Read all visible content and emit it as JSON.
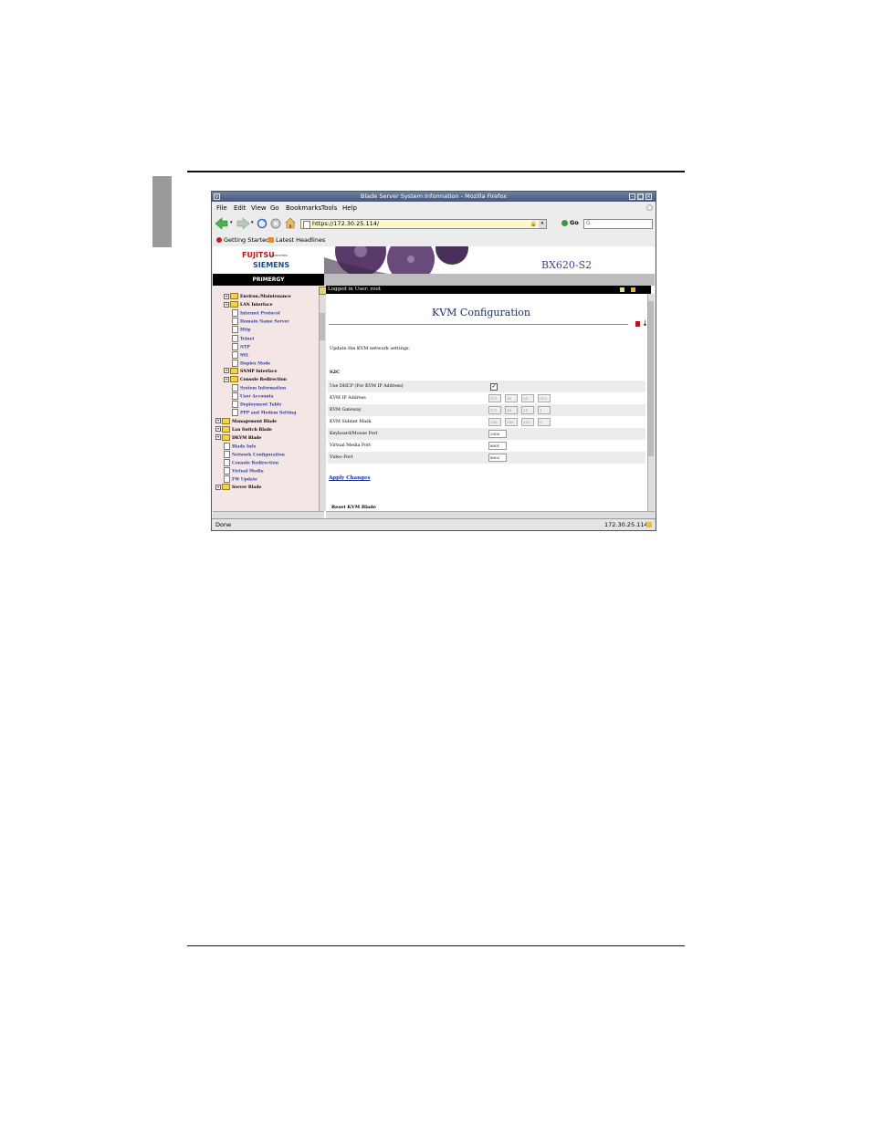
{
  "browser": {
    "window_title": "Blade Server System Information - Mozilla Firefox",
    "menu": [
      "File",
      "Edit",
      "View",
      "Go",
      "Bookmarks",
      "Tools",
      "Help"
    ],
    "url": "https://172.30.25.114/",
    "go_label": "Go",
    "bookmarks": [
      "Getting Started",
      "Latest Headlines"
    ],
    "status_left": "Done",
    "status_right": "172.30.25.114"
  },
  "banner": {
    "brand_top": "FUJITSU",
    "brand_small": "COMPUTERS",
    "brand_bottom": "SIEMENS",
    "model": "BX620-S2",
    "primergy": "PRIMERGY"
  },
  "tree": {
    "items": [
      {
        "label": "Environ./Maintenance",
        "type": "folder"
      },
      {
        "label": "LAN Interface",
        "type": "folder"
      },
      {
        "label": "Internet Protocol",
        "type": "doc"
      },
      {
        "label": "Domain Name Server",
        "type": "doc"
      },
      {
        "label": "Http",
        "type": "doc"
      },
      {
        "label": "Telnet",
        "type": "doc"
      },
      {
        "label": "NTP",
        "type": "doc"
      },
      {
        "label": "SSL",
        "type": "doc"
      },
      {
        "label": "Duplex Mode",
        "type": "doc"
      },
      {
        "label": "SNMP Interface",
        "type": "folder"
      },
      {
        "label": "Console Redirection",
        "type": "folder"
      },
      {
        "label": "System Information",
        "type": "doc"
      },
      {
        "label": "User Accounts",
        "type": "doc"
      },
      {
        "label": "Deployment Table",
        "type": "doc"
      },
      {
        "label": "PPP and Modem Setting",
        "type": "doc"
      },
      {
        "label": "Management Blade",
        "type": "folder"
      },
      {
        "label": "Lan Switch Blade",
        "type": "folder"
      },
      {
        "label": "DKVM Blade",
        "type": "folder"
      },
      {
        "label": "Blade Info",
        "type": "doc"
      },
      {
        "label": "Network Configuration",
        "type": "doc"
      },
      {
        "label": "Console Redirection",
        "type": "doc"
      },
      {
        "label": "Virtual Media",
        "type": "doc"
      },
      {
        "label": "FW Update",
        "type": "doc"
      },
      {
        "label": "Server Blade",
        "type": "folder"
      }
    ]
  },
  "main": {
    "logged_in": "Logged in User: root",
    "page_title": "KVM Configuration",
    "intro": "Update the KVM network settings.",
    "section": "S2C",
    "dhcp_label": "Use DHCP (For KVM IP Address)",
    "dhcp_checked": true,
    "ip_label": "KVM IP Address",
    "ip": [
      "172",
      "30",
      "25",
      "213"
    ],
    "gateway_label": "KVM Gateway",
    "gateway": [
      "172",
      "30",
      "25",
      "1"
    ],
    "mask_label": "KVM Subnet Mask",
    "mask": [
      "255",
      "255",
      "252",
      "0"
    ],
    "kbd_label": "Keyboard/Mouse Port",
    "kbd_port": "2000",
    "vmedia_label": "Virtual Media Port",
    "vmedia_port": "8001",
    "video_label": "Video Port",
    "video_port": "8002",
    "apply_label": "Apply Changes",
    "reset_label": "Reset KVM Blade"
  }
}
